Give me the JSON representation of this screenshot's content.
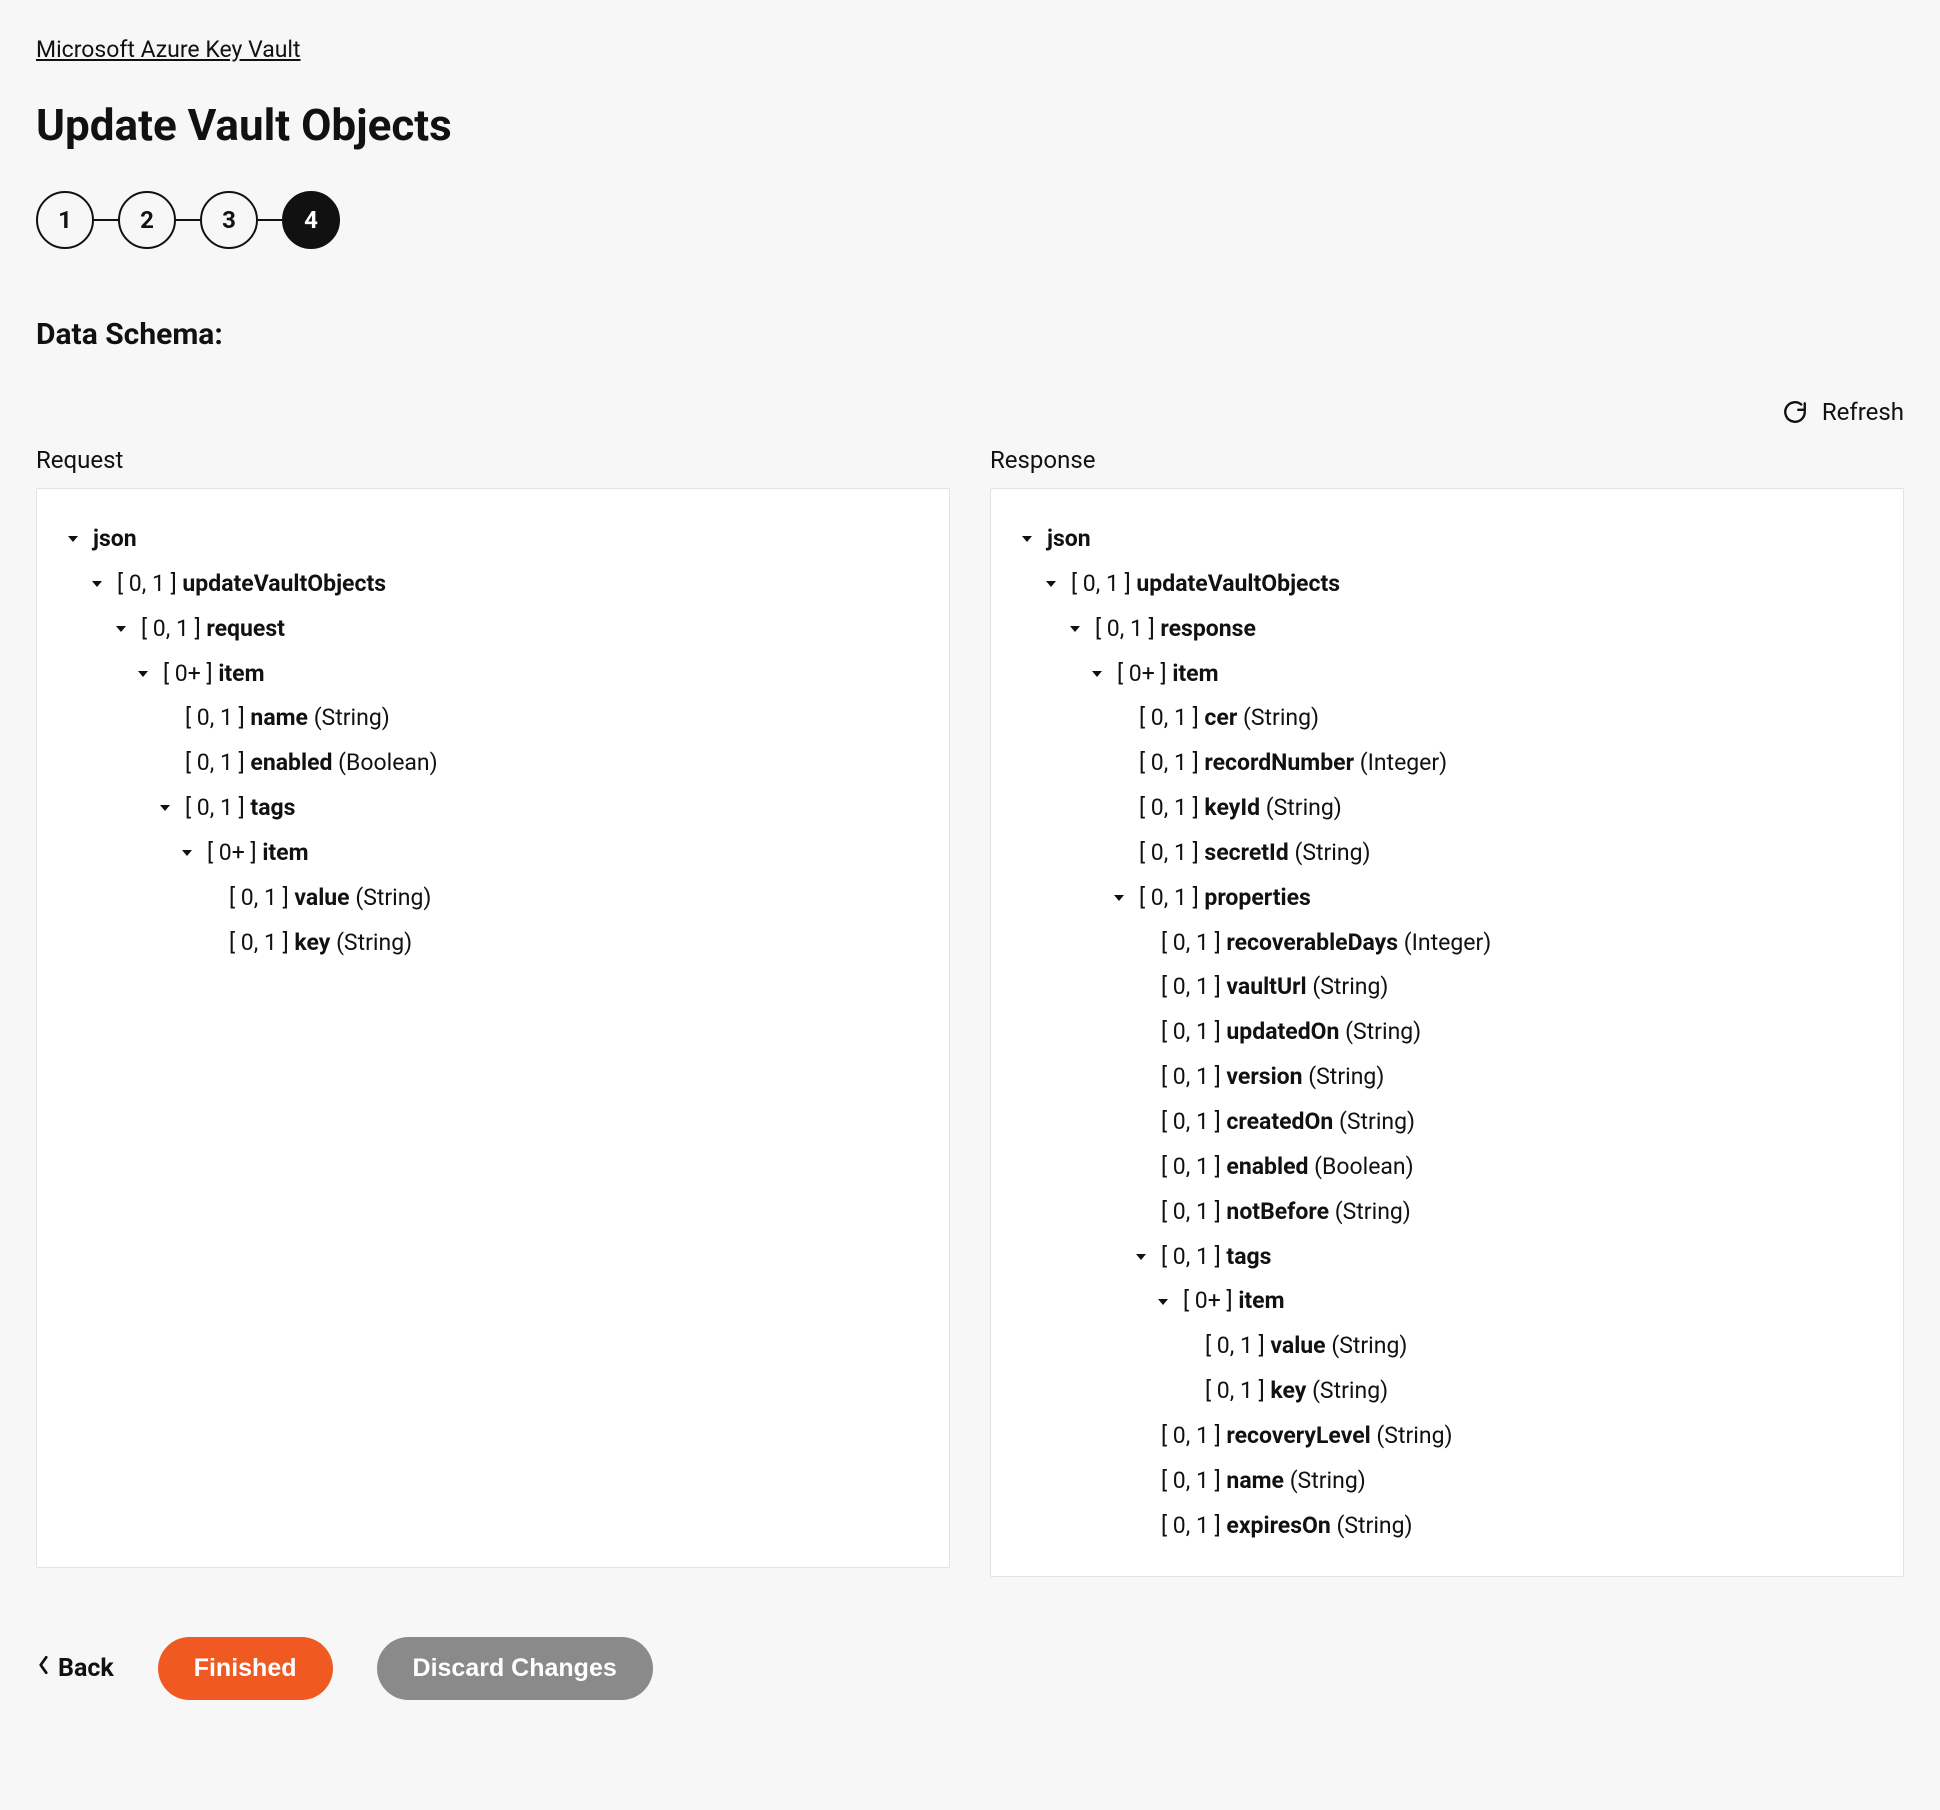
{
  "breadcrumb": "Microsoft Azure Key Vault",
  "page_title": "Update Vault Objects",
  "stepper": {
    "steps": [
      "1",
      "2",
      "3",
      "4"
    ],
    "active_index": 3
  },
  "section_heading": "Data Schema:",
  "refresh_label": "Refresh",
  "panels": {
    "request": {
      "label": "Request",
      "tree": [
        {
          "indent": 0,
          "chevron": true,
          "name": "json"
        },
        {
          "indent": 1,
          "chevron": true,
          "cardinality": "[ 0, 1 ]",
          "name": "updateVaultObjects"
        },
        {
          "indent": 2,
          "chevron": true,
          "cardinality": "[ 0, 1 ]",
          "name": "request"
        },
        {
          "indent": 3,
          "chevron": true,
          "cardinality": "[ 0+ ]",
          "name": "item"
        },
        {
          "indent": 4,
          "chevron": false,
          "cardinality": "[ 0, 1 ]",
          "name": "name",
          "type": "(String)"
        },
        {
          "indent": 4,
          "chevron": false,
          "cardinality": "[ 0, 1 ]",
          "name": "enabled",
          "type": "(Boolean)"
        },
        {
          "indent": 4,
          "chevron": true,
          "cardinality": "[ 0, 1 ]",
          "name": "tags"
        },
        {
          "indent": 5,
          "chevron": true,
          "cardinality": "[ 0+ ]",
          "name": "item"
        },
        {
          "indent": 6,
          "chevron": false,
          "cardinality": "[ 0, 1 ]",
          "name": "value",
          "type": "(String)"
        },
        {
          "indent": 6,
          "chevron": false,
          "cardinality": "[ 0, 1 ]",
          "name": "key",
          "type": "(String)"
        }
      ]
    },
    "response": {
      "label": "Response",
      "tree": [
        {
          "indent": 0,
          "chevron": true,
          "name": "json"
        },
        {
          "indent": 1,
          "chevron": true,
          "cardinality": "[ 0, 1 ]",
          "name": "updateVaultObjects"
        },
        {
          "indent": 2,
          "chevron": true,
          "cardinality": "[ 0, 1 ]",
          "name": "response"
        },
        {
          "indent": 3,
          "chevron": true,
          "cardinality": "[ 0+ ]",
          "name": "item"
        },
        {
          "indent": 4,
          "chevron": false,
          "cardinality": "[ 0, 1 ]",
          "name": "cer",
          "type": "(String)"
        },
        {
          "indent": 4,
          "chevron": false,
          "cardinality": "[ 0, 1 ]",
          "name": "recordNumber",
          "type": "(Integer)"
        },
        {
          "indent": 4,
          "chevron": false,
          "cardinality": "[ 0, 1 ]",
          "name": "keyId",
          "type": "(String)"
        },
        {
          "indent": 4,
          "chevron": false,
          "cardinality": "[ 0, 1 ]",
          "name": "secretId",
          "type": "(String)"
        },
        {
          "indent": 4,
          "chevron": true,
          "cardinality": "[ 0, 1 ]",
          "name": "properties"
        },
        {
          "indent": 5,
          "chevron": false,
          "cardinality": "[ 0, 1 ]",
          "name": "recoverableDays",
          "type": "(Integer)"
        },
        {
          "indent": 5,
          "chevron": false,
          "cardinality": "[ 0, 1 ]",
          "name": "vaultUrl",
          "type": "(String)"
        },
        {
          "indent": 5,
          "chevron": false,
          "cardinality": "[ 0, 1 ]",
          "name": "updatedOn",
          "type": "(String)"
        },
        {
          "indent": 5,
          "chevron": false,
          "cardinality": "[ 0, 1 ]",
          "name": "version",
          "type": "(String)"
        },
        {
          "indent": 5,
          "chevron": false,
          "cardinality": "[ 0, 1 ]",
          "name": "createdOn",
          "type": "(String)"
        },
        {
          "indent": 5,
          "chevron": false,
          "cardinality": "[ 0, 1 ]",
          "name": "enabled",
          "type": "(Boolean)"
        },
        {
          "indent": 5,
          "chevron": false,
          "cardinality": "[ 0, 1 ]",
          "name": "notBefore",
          "type": "(String)"
        },
        {
          "indent": 5,
          "chevron": true,
          "cardinality": "[ 0, 1 ]",
          "name": "tags"
        },
        {
          "indent": 6,
          "chevron": true,
          "cardinality": "[ 0+ ]",
          "name": "item"
        },
        {
          "indent": 7,
          "chevron": false,
          "cardinality": "[ 0, 1 ]",
          "name": "value",
          "type": "(String)"
        },
        {
          "indent": 7,
          "chevron": false,
          "cardinality": "[ 0, 1 ]",
          "name": "key",
          "type": "(String)"
        },
        {
          "indent": 5,
          "chevron": false,
          "cardinality": "[ 0, 1 ]",
          "name": "recoveryLevel",
          "type": "(String)"
        },
        {
          "indent": 5,
          "chevron": false,
          "cardinality": "[ 0, 1 ]",
          "name": "name",
          "type": "(String)"
        },
        {
          "indent": 5,
          "chevron": false,
          "cardinality": "[ 0, 1 ]",
          "name": "expiresOn",
          "type": "(String)"
        }
      ]
    }
  },
  "footer": {
    "back": "Back",
    "finished": "Finished",
    "discard": "Discard Changes"
  }
}
